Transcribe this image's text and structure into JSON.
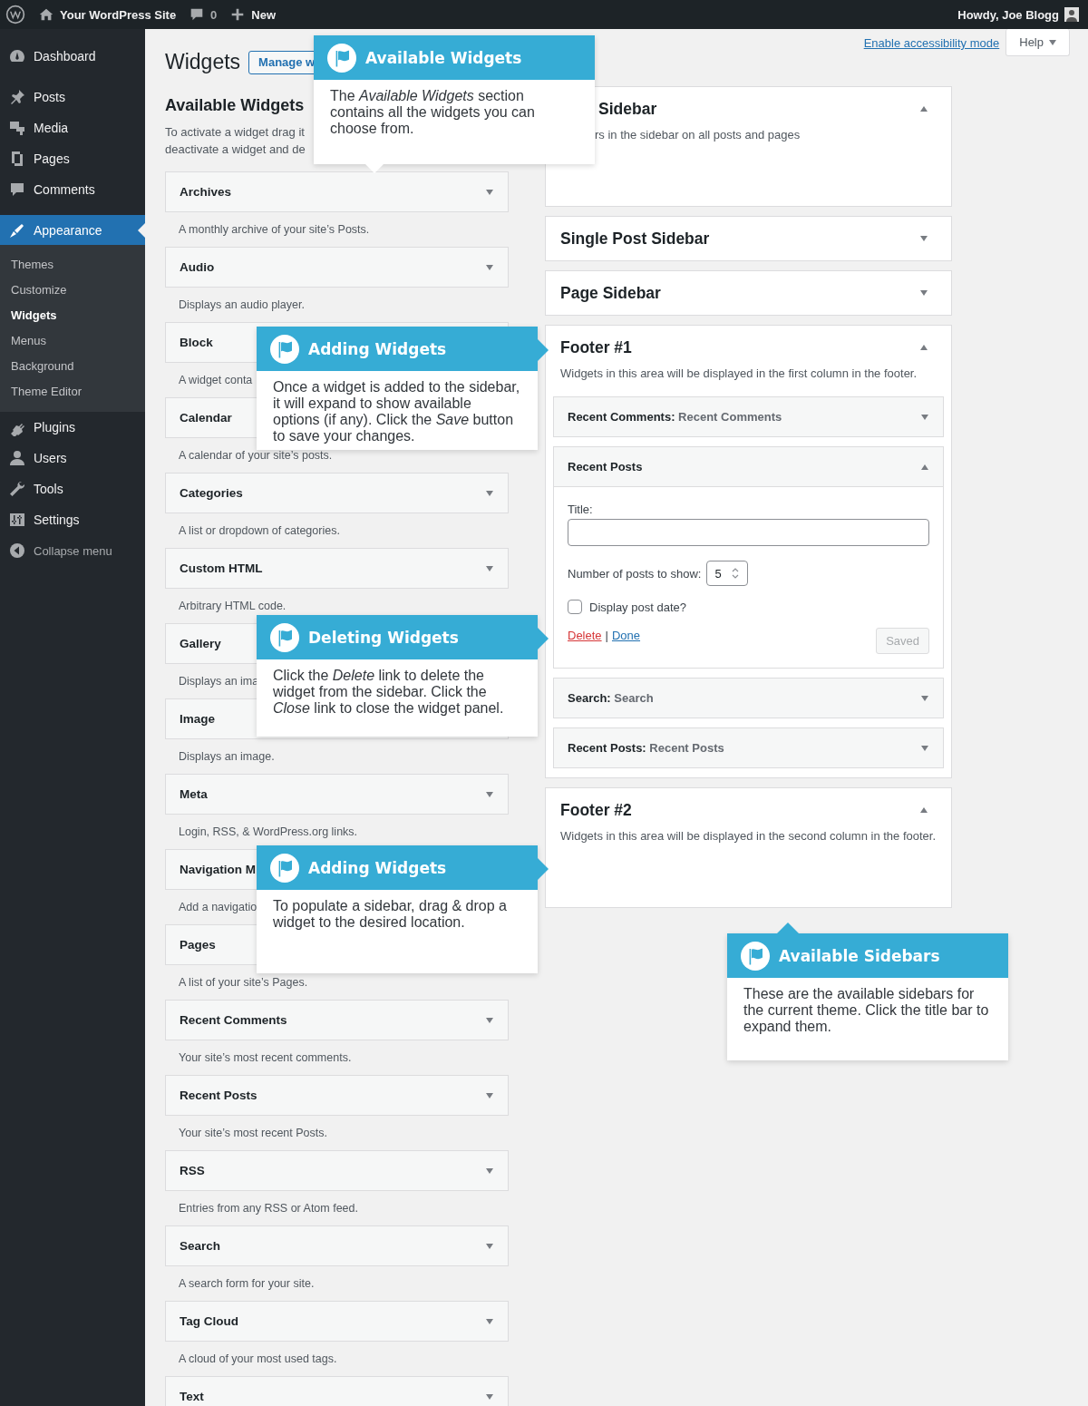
{
  "admin_bar": {
    "site": "Your WordPress Site",
    "comments": "0",
    "new": "New",
    "greeting": "Howdy, Joe Blogg"
  },
  "menu": {
    "groups": [
      {
        "items": [
          {
            "label": "Dashboard",
            "selected": false
          }
        ]
      },
      {
        "items": [
          {
            "label": "Posts",
            "selected": false
          },
          {
            "label": "Media",
            "selected": false
          },
          {
            "label": "Pages",
            "selected": false
          },
          {
            "label": "Comments",
            "selected": false
          }
        ]
      },
      {
        "items": [
          {
            "label": "Appearance",
            "selected": true,
            "submenu": [
              {
                "label": "Themes",
                "selected": false
              },
              {
                "label": "Customize",
                "selected": false
              },
              {
                "label": "Widgets",
                "selected": true
              },
              {
                "label": "Menus",
                "selected": false
              },
              {
                "label": "Background",
                "selected": false
              },
              {
                "label": "Theme Editor",
                "selected": false
              }
            ]
          },
          {
            "label": "Plugins",
            "selected": false
          },
          {
            "label": "Users",
            "selected": false
          },
          {
            "label": "Tools",
            "selected": false
          },
          {
            "label": "Settings",
            "selected": false
          }
        ]
      }
    ],
    "collapse": "Collapse menu"
  },
  "page": {
    "title": "Widgets",
    "manage_button": "Manage w",
    "accessibility_link": "Enable accessibility mode",
    "help": "Help"
  },
  "available": {
    "heading": "Available Widgets",
    "intro": [
      "To activate a widget drag it",
      "deactivate a widget and de"
    ],
    "widgets": [
      {
        "name": "Archives",
        "description": "A monthly archive of your site’s Posts.",
        "caret": true
      },
      {
        "name": "Audio",
        "description": "Displays an audio player.",
        "caret": true
      },
      {
        "name": "Block",
        "description": "A widget conta"
      },
      {
        "name": "Calendar",
        "description": "A calendar of your site’s posts."
      },
      {
        "name": "Categories",
        "description": "A list or dropdown of categories.",
        "caret": true
      },
      {
        "name": "Custom HTML",
        "description": "Arbitrary HTML code.",
        "caret": true
      },
      {
        "name": "Gallery",
        "description": "Displays an ima"
      },
      {
        "name": "Image",
        "description": "Displays an image."
      },
      {
        "name": "Meta",
        "description": "Login, RSS, & WordPress.org links.",
        "caret": true
      },
      {
        "name": "Navigation M",
        "description": "Add a navigatio"
      },
      {
        "name": "Pages",
        "description": "A list of your site’s Pages."
      },
      {
        "name": "Recent Comments",
        "description": "Your site’s most recent comments.",
        "caret": true
      },
      {
        "name": "Recent Posts",
        "description": "Your site’s most recent Posts.",
        "caret": true
      },
      {
        "name": "RSS",
        "description": "Entries from any RSS or Atom feed.",
        "caret": true
      },
      {
        "name": "Search",
        "description": "A search form for your site.",
        "caret": true
      },
      {
        "name": "Tag Cloud",
        "description": "A cloud of your most used tags.",
        "caret": true
      },
      {
        "name": "Text",
        "caret": true
      }
    ]
  },
  "sidebars": [
    {
      "title": "Sidebar",
      "expanded": true,
      "clipped": true,
      "description": "rs in the sidebar on all posts and pages"
    },
    {
      "title": "Single Post Sidebar",
      "expanded": false
    },
    {
      "title": "Page Sidebar",
      "expanded": false
    },
    {
      "title": "Footer #1",
      "expanded": true,
      "description": "Widgets in this area will be displayed in the first column in the footer.",
      "widgets": [
        {
          "name": "Recent Comments:",
          "title": "Recent Comments",
          "expanded": false
        },
        {
          "name": "Recent Posts",
          "expanded": true,
          "form": {
            "title_label": "Title:",
            "count_label": "Number of posts to show:",
            "count": "5",
            "date_label": "Display post date?",
            "date_checked": false,
            "delete": "Delete",
            "separator": "|",
            "done": "Done",
            "save": "Saved",
            "save_disabled": true
          }
        },
        {
          "name": "Search:",
          "title": "Search",
          "expanded": false
        },
        {
          "name": "Recent Posts:",
          "title": "Recent Posts",
          "expanded": false
        }
      ]
    },
    {
      "title": "Footer #2",
      "expanded": true,
      "description": "Widgets in this area will be displayed in the second column in the footer."
    }
  ],
  "callouts": [
    {
      "title": "Available Widgets",
      "body": "The *Available Widgets* section contains all the widgets you can choose from.",
      "kind": "down"
    },
    {
      "title": "Adding Widgets",
      "body": "Once a widget is added to the sidebar, it will expand to show available options (if any). Click the *Save* button to save your changes.",
      "kind": "right"
    },
    {
      "title": "Deleting Widgets",
      "body": "Click the *Delete* link to delete the widget from the sidebar. Click the *Close* link to close the widget panel.",
      "kind": "right"
    },
    {
      "title": "Adding Widgets",
      "body": "To populate a sidebar, drag & drop a widget to the desired location.",
      "kind": "right"
    },
    {
      "title": "Available Sidebars",
      "body": "These are the available sidebars for the current theme. Click the title bar to expand them.",
      "kind": "up"
    }
  ]
}
